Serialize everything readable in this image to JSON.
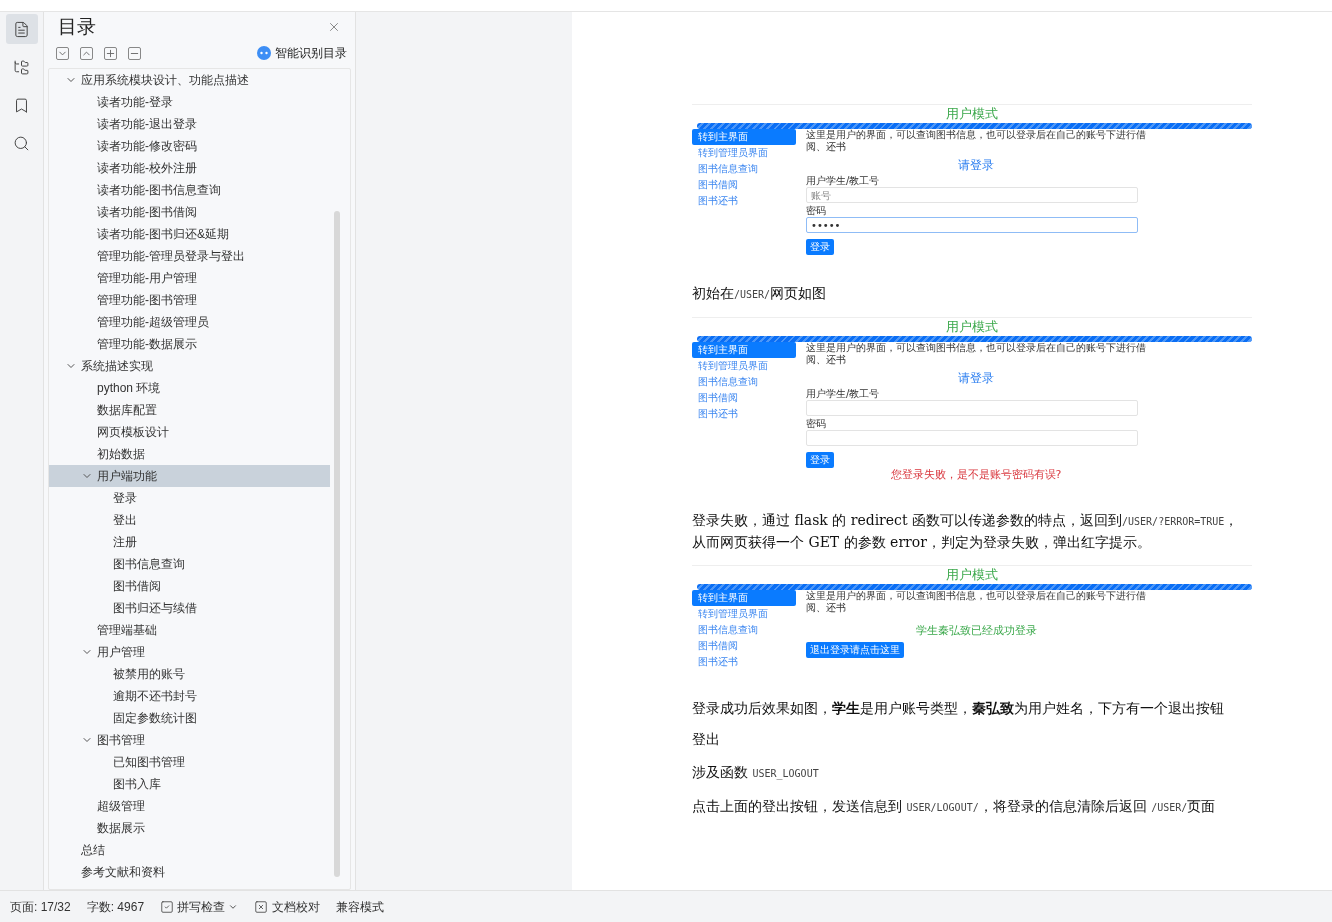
{
  "nav_rail": [
    {
      "kind": "outline",
      "selected": true
    },
    {
      "kind": "structure",
      "selected": false
    },
    {
      "kind": "bookmark",
      "selected": false
    },
    {
      "kind": "search",
      "selected": false
    }
  ],
  "toc": {
    "title": "目录",
    "smart_button": "智能识别目录",
    "items": [
      {
        "label": "应用系统模块设计、功能点描述",
        "selected": false,
        "expanded": true,
        "children": [
          {
            "label": "读者功能-登录",
            "selected": false
          },
          {
            "label": "读者功能-退出登录",
            "selected": false
          },
          {
            "label": "读者功能-修改密码",
            "selected": false
          },
          {
            "label": "读者功能-校外注册",
            "selected": false
          },
          {
            "label": "读者功能-图书信息查询",
            "selected": false
          },
          {
            "label": "读者功能-图书借阅",
            "selected": false
          },
          {
            "label": "读者功能-图书归还&延期",
            "selected": false
          },
          {
            "label": "管理功能-管理员登录与登出",
            "selected": false
          },
          {
            "label": "管理功能-用户管理",
            "selected": false
          },
          {
            "label": "管理功能-图书管理",
            "selected": false
          },
          {
            "label": "管理功能-超级管理员",
            "selected": false
          },
          {
            "label": "管理功能-数据展示",
            "selected": false
          }
        ]
      },
      {
        "label": "系统描述实现",
        "selected": false,
        "expanded": true,
        "children": [
          {
            "label": "python 环境",
            "selected": false
          },
          {
            "label": "数据库配置",
            "selected": false
          },
          {
            "label": "网页模板设计",
            "selected": false
          },
          {
            "label": "初始数据",
            "selected": false
          },
          {
            "label": "用户端功能",
            "selected": true,
            "expanded": true,
            "children": [
              {
                "label": "登录",
                "selected": false
              },
              {
                "label": "登出",
                "selected": false
              },
              {
                "label": "注册",
                "selected": false
              },
              {
                "label": "图书信息查询",
                "selected": false
              },
              {
                "label": "图书借阅",
                "selected": false
              },
              {
                "label": "图书归还与续借",
                "selected": false
              }
            ]
          },
          {
            "label": "管理端基础",
            "selected": false
          },
          {
            "label": "用户管理",
            "selected": false,
            "expanded": true,
            "children": [
              {
                "label": "被禁用的账号",
                "selected": false
              },
              {
                "label": "逾期不还书封号",
                "selected": false
              },
              {
                "label": "固定参数统计图",
                "selected": false
              }
            ]
          },
          {
            "label": "图书管理",
            "selected": false,
            "expanded": true,
            "children": [
              {
                "label": "已知图书管理",
                "selected": false
              },
              {
                "label": "图书入库",
                "selected": false
              }
            ]
          },
          {
            "label": "超级管理",
            "selected": false
          },
          {
            "label": "数据展示",
            "selected": false
          }
        ]
      },
      {
        "label": "总结",
        "selected": false
      },
      {
        "label": "参考文献和资料",
        "selected": false
      }
    ]
  },
  "document": [
    {
      "kind": "screenshot",
      "title": "用户模式",
      "nav": [
        {
          "label": "转到主界面",
          "selected": true
        },
        {
          "label": "转到管理员界面",
          "selected": false
        },
        {
          "label": "图书信息查询",
          "selected": false
        },
        {
          "label": "图书借阅",
          "selected": false
        },
        {
          "label": "图书还书",
          "selected": false
        }
      ],
      "intro": "这里是用户的界面，可以查询图书信息，也可以登录后在自己的账号下进行借阅、还书",
      "body": {
        "kind": "login",
        "heading": "请登录",
        "fields": [
          {
            "label": "用户学生/教工号",
            "placeholder": "账号",
            "focused": false
          },
          {
            "label": "密码",
            "value": "•••••",
            "focused": true
          }
        ],
        "button": "登录"
      }
    },
    {
      "kind": "paragraph",
      "segments": [
        {
          "kind": "text",
          "text": "初始在"
        },
        {
          "kind": "code",
          "text": "/USER/"
        },
        {
          "kind": "text",
          "text": "网页如图"
        }
      ]
    },
    {
      "kind": "screenshot",
      "title": "用户模式",
      "nav": [
        {
          "label": "转到主界面",
          "selected": true
        },
        {
          "label": "转到管理员界面",
          "selected": false
        },
        {
          "label": "图书信息查询",
          "selected": false
        },
        {
          "label": "图书借阅",
          "selected": false
        },
        {
          "label": "图书还书",
          "selected": false
        }
      ],
      "intro": "这里是用户的界面，可以查询图书信息，也可以登录后在自己的账号下进行借阅、还书",
      "body": {
        "kind": "login",
        "heading": "请登录",
        "fields": [
          {
            "label": "用户学生/教工号",
            "focused": false
          },
          {
            "label": "密码",
            "focused": false
          }
        ],
        "button": "登录",
        "error": "您登录失败，是不是账号密码有误?"
      }
    },
    {
      "kind": "paragraph",
      "segments": [
        {
          "kind": "text",
          "text": "登录失败，通过 flask 的 redirect 函数可以传递参数的特点，返回到"
        },
        {
          "kind": "code",
          "text": "/USER/?ERROR=TRUE"
        },
        {
          "kind": "text",
          "text": "，从而网页获得一个 GET 的参数 error，判定为登录失败，弹出红字提示。"
        }
      ]
    },
    {
      "kind": "screenshot",
      "title": "用户模式",
      "nav": [
        {
          "label": "转到主界面",
          "selected": true
        },
        {
          "label": "转到管理员界面",
          "selected": false
        },
        {
          "label": "图书信息查询",
          "selected": false
        },
        {
          "label": "图书借阅",
          "selected": false
        },
        {
          "label": "图书还书",
          "selected": false
        }
      ],
      "intro": "这里是用户的界面，可以查询图书信息，也可以登录后在自己的账号下进行借阅、还书",
      "body": {
        "kind": "logged_in",
        "message": "学生秦弘致已经成功登录",
        "button": "退出登录请点击这里"
      }
    },
    {
      "kind": "paragraph",
      "segments": [
        {
          "kind": "text",
          "text": "登录成功后效果如图，**学生**是用户账号类型，**秦弘致**为用户姓名，下方有一个退出按钮"
        }
      ]
    },
    {
      "kind": "paragraph",
      "segments": [
        {
          "kind": "text",
          "text": "登出"
        }
      ]
    },
    {
      "kind": "paragraph",
      "segments": [
        {
          "kind": "text",
          "text": "涉及函数 "
        },
        {
          "kind": "code",
          "text": "USER_LOGOUT"
        }
      ]
    },
    {
      "kind": "paragraph",
      "segments": [
        {
          "kind": "text",
          "text": "点击上面的登出按钮，发送信息到 "
        },
        {
          "kind": "code",
          "text": "USER/LOGOUT/"
        },
        {
          "kind": "text",
          "text": "，将登录的信息清除后返回 "
        },
        {
          "kind": "code",
          "text": "/USER/"
        },
        {
          "kind": "text",
          "text": "页面"
        }
      ]
    }
  ],
  "status_bar": {
    "page": "页面: 17/32",
    "words": "字数: 4967",
    "spell_check": "拼写检查",
    "proofread": "文档校对",
    "mode": "兼容模式"
  }
}
